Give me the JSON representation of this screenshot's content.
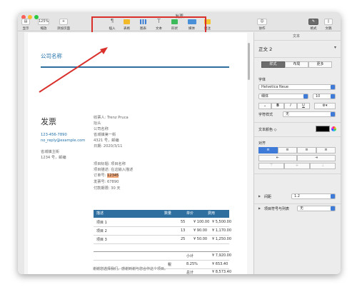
{
  "window": {
    "title": "发票"
  },
  "toolbar": {
    "left": [
      {
        "name": "view-button",
        "label": "显示",
        "icon": "▤"
      },
      {
        "name": "zoom-select",
        "label": "缩放",
        "value": "125%"
      },
      {
        "name": "add-page-button",
        "label": "添加页面",
        "icon": "+"
      }
    ],
    "insert": [
      {
        "name": "insert-button",
        "label": "插入",
        "icon": "¶",
        "color": "#8a8a8a"
      },
      {
        "name": "table-button",
        "label": "表格",
        "color": "#f2b92b"
      },
      {
        "name": "chart-button",
        "label": "图表",
        "color": "#3b7fd4"
      },
      {
        "name": "text-button",
        "label": "文本",
        "icon": "T",
        "color": "#8a8a8a"
      },
      {
        "name": "shape-button",
        "label": "形状",
        "color": "#3dbb5a"
      },
      {
        "name": "media-button",
        "label": "媒体",
        "color": "#4a90d9"
      },
      {
        "name": "comment-button",
        "label": "批注",
        "color": "#f2c531"
      }
    ],
    "right": [
      {
        "name": "collaborate-button",
        "label": "协作"
      },
      {
        "name": "format-button",
        "label": "格式"
      },
      {
        "name": "document-button",
        "label": "文稿"
      }
    ]
  },
  "colors": {
    "accent": "#3e7bd8",
    "header": "#2f6fa0",
    "highlight": "#f4a97a",
    "red": "#d9302c"
  },
  "doc": {
    "company": "公司名称",
    "invoice_title": "发票",
    "phone": "123-456-7890",
    "email": "no_reply@example.com",
    "address": [
      "省城镇主街",
      "1234 号，邮编"
    ],
    "recipient": [
      "收票人: Trenz Pruca",
      "抬头",
      "公司名称",
      "省城镇第一街",
      "4321 号，邮编",
      "日期: 2020/3/11"
    ],
    "project": [
      "项目标题: 项目名称",
      "项目描述: 在这输入描述"
    ],
    "order_label": "订单号: ",
    "order_no": "12345",
    "bill_no": "发票号: 67890",
    "due": "付款期限: 30 天",
    "table": {
      "headers": [
        "描述",
        "数量",
        "单价",
        "费用"
      ],
      "rows": [
        [
          "项目 1",
          "55",
          "¥ 100.00",
          "¥ 5,500.00"
        ],
        [
          "项目 2",
          "13",
          "¥ 90.00",
          "¥ 1,170.00"
        ],
        [
          "项目 3",
          "25",
          "¥ 50.00",
          "¥ 1,250.00"
        ]
      ],
      "subtotal": [
        "小计",
        "¥ 7,920.00"
      ],
      "tax": [
        "税",
        "8.25%",
        "¥ 653.40"
      ],
      "total": [
        "总计",
        "¥ 8,573.40"
      ]
    },
    "footer": "谢谢您选择我们。感谢到谢与您合作这个项目。"
  },
  "panel": {
    "tab_heading": "文本",
    "style_name": "正文 2",
    "tabs": [
      "样式",
      "布局",
      "更多"
    ],
    "font_label": "字体",
    "font_name": "Helvetica Neue",
    "font_weight": "细体",
    "font_size": "10",
    "bold": "B",
    "italic": "I",
    "underline": "U",
    "char_style_label": "字符样式",
    "char_style": "无",
    "color_label": "文本颜色 ◇",
    "text_color": "#000000",
    "align_label": "对齐",
    "spacing_label": "间距",
    "spacing_value": "1.2",
    "bullets_label": "项目符号与列表",
    "bullets_value": "无"
  }
}
